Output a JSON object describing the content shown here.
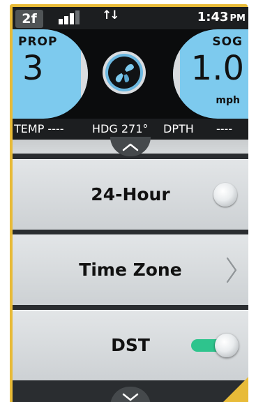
{
  "status": {
    "badge": "2f",
    "signal_bars_on": 3,
    "signal_bars_total": 5,
    "data_arrows": "↑↓",
    "time": "1:43",
    "ampm": "PM"
  },
  "gauges": {
    "prop": {
      "label": "PROP",
      "value": "3"
    },
    "sog": {
      "label": "SOG",
      "value": "1.0",
      "unit": "mph"
    }
  },
  "strip": {
    "temp": "TEMP ----",
    "hdg": "HDG 271°",
    "dpth": "DPTH",
    "dpth_value": "----"
  },
  "settings": {
    "items": [
      {
        "label": "24-Hour",
        "control": "radio",
        "selected": false
      },
      {
        "label": "Time Zone",
        "control": "chevron"
      },
      {
        "label": "DST",
        "control": "toggle",
        "on": true
      }
    ]
  },
  "colors": {
    "frame": "#e8bb38",
    "gauge_blue": "#7dcaee",
    "toggle_on": "#2ec48d",
    "row_bg": "#d8dbdd"
  },
  "icons": [
    "signal-icon",
    "data-arrows-icon",
    "propeller-icon",
    "chevron-up-icon",
    "chevron-right-icon",
    "chevron-down-icon"
  ]
}
